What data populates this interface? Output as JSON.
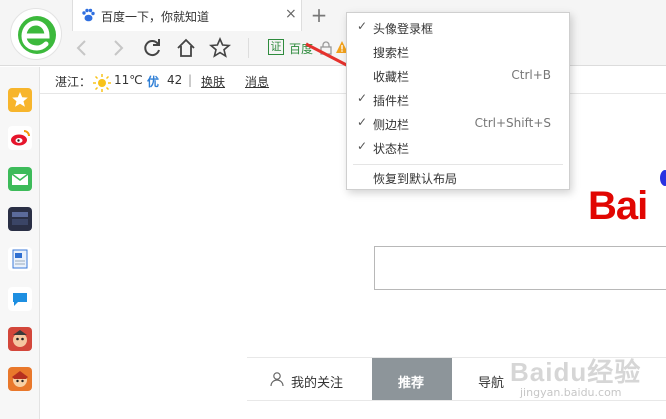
{
  "browser": {
    "tab": {
      "title": "百度一下，你就知道",
      "close_glyph": "×"
    },
    "new_tab_glyph": "+",
    "toolbar": {
      "icons": [
        "back-icon",
        "forward-icon",
        "reload-icon",
        "home-icon",
        "star-icon"
      ],
      "cert_badge": "证",
      "site_name": "百度"
    }
  },
  "infobar": {
    "city": "湛江：",
    "temperature": "11℃",
    "aqi_label": "优",
    "aqi_value": "42",
    "aqi_separator": "|",
    "skin_link": "换肤",
    "messages_link": "消息"
  },
  "sidebar": {
    "items": [
      "favorites-icon",
      "weibo-icon",
      "mail-icon",
      "game-news-icon",
      "word-doc-icon",
      "chat-icon",
      "game-app-icon-1",
      "game-app-icon-2"
    ]
  },
  "menu": {
    "items": [
      {
        "label": "头像登录框",
        "checked": true,
        "shortcut": ""
      },
      {
        "label": "搜索栏",
        "checked": false,
        "shortcut": ""
      },
      {
        "label": "收藏栏",
        "checked": false,
        "shortcut": "Ctrl+B"
      },
      {
        "label": "插件栏",
        "checked": true,
        "shortcut": ""
      },
      {
        "label": "侧边栏",
        "checked": true,
        "shortcut": "Ctrl+Shift+S"
      },
      {
        "label": "状态栏",
        "checked": true,
        "shortcut": ""
      },
      {
        "label": "恢复到默认布局",
        "checked": false,
        "shortcut": ""
      }
    ],
    "check_glyph": "✓"
  },
  "page": {
    "logo_text": "Bai",
    "tabs": {
      "follow": "我的关注",
      "recommend": "推荐",
      "nav": "导航"
    },
    "watermark": "Baidu经验",
    "watermark_url": "jingyan.baidu.com"
  },
  "colors": {
    "accent_green": "#2e8b3d",
    "baidu_red": "#e10602",
    "baidu_blue": "#2932e1",
    "arrow_red": "#e5322d",
    "aqi_blue": "#2f7fd6"
  }
}
